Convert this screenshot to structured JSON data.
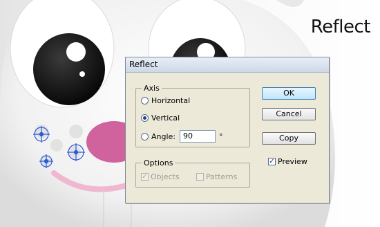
{
  "heading": "Reflect",
  "dialog": {
    "title": "Reflect",
    "axis": {
      "legend": "Axis",
      "horizontal_label": "Horizontal",
      "vertical_label": "Vertical",
      "angle_label": "Angle:",
      "angle_value": "90",
      "degree_symbol": "°",
      "selected": "vertical"
    },
    "options": {
      "legend": "Options",
      "objects_label": "Objects",
      "objects_checked": true,
      "patterns_label": "Patterns",
      "patterns_checked": false
    },
    "buttons": {
      "ok": "OK",
      "cancel": "Cancel",
      "copy": "Copy"
    },
    "preview": {
      "label": "Preview",
      "checked": true
    }
  },
  "colors": {
    "cheek_pink": "#d0629e",
    "mouth_pink": "#f0b7d0",
    "selection_blue": "#2c5ad6"
  }
}
